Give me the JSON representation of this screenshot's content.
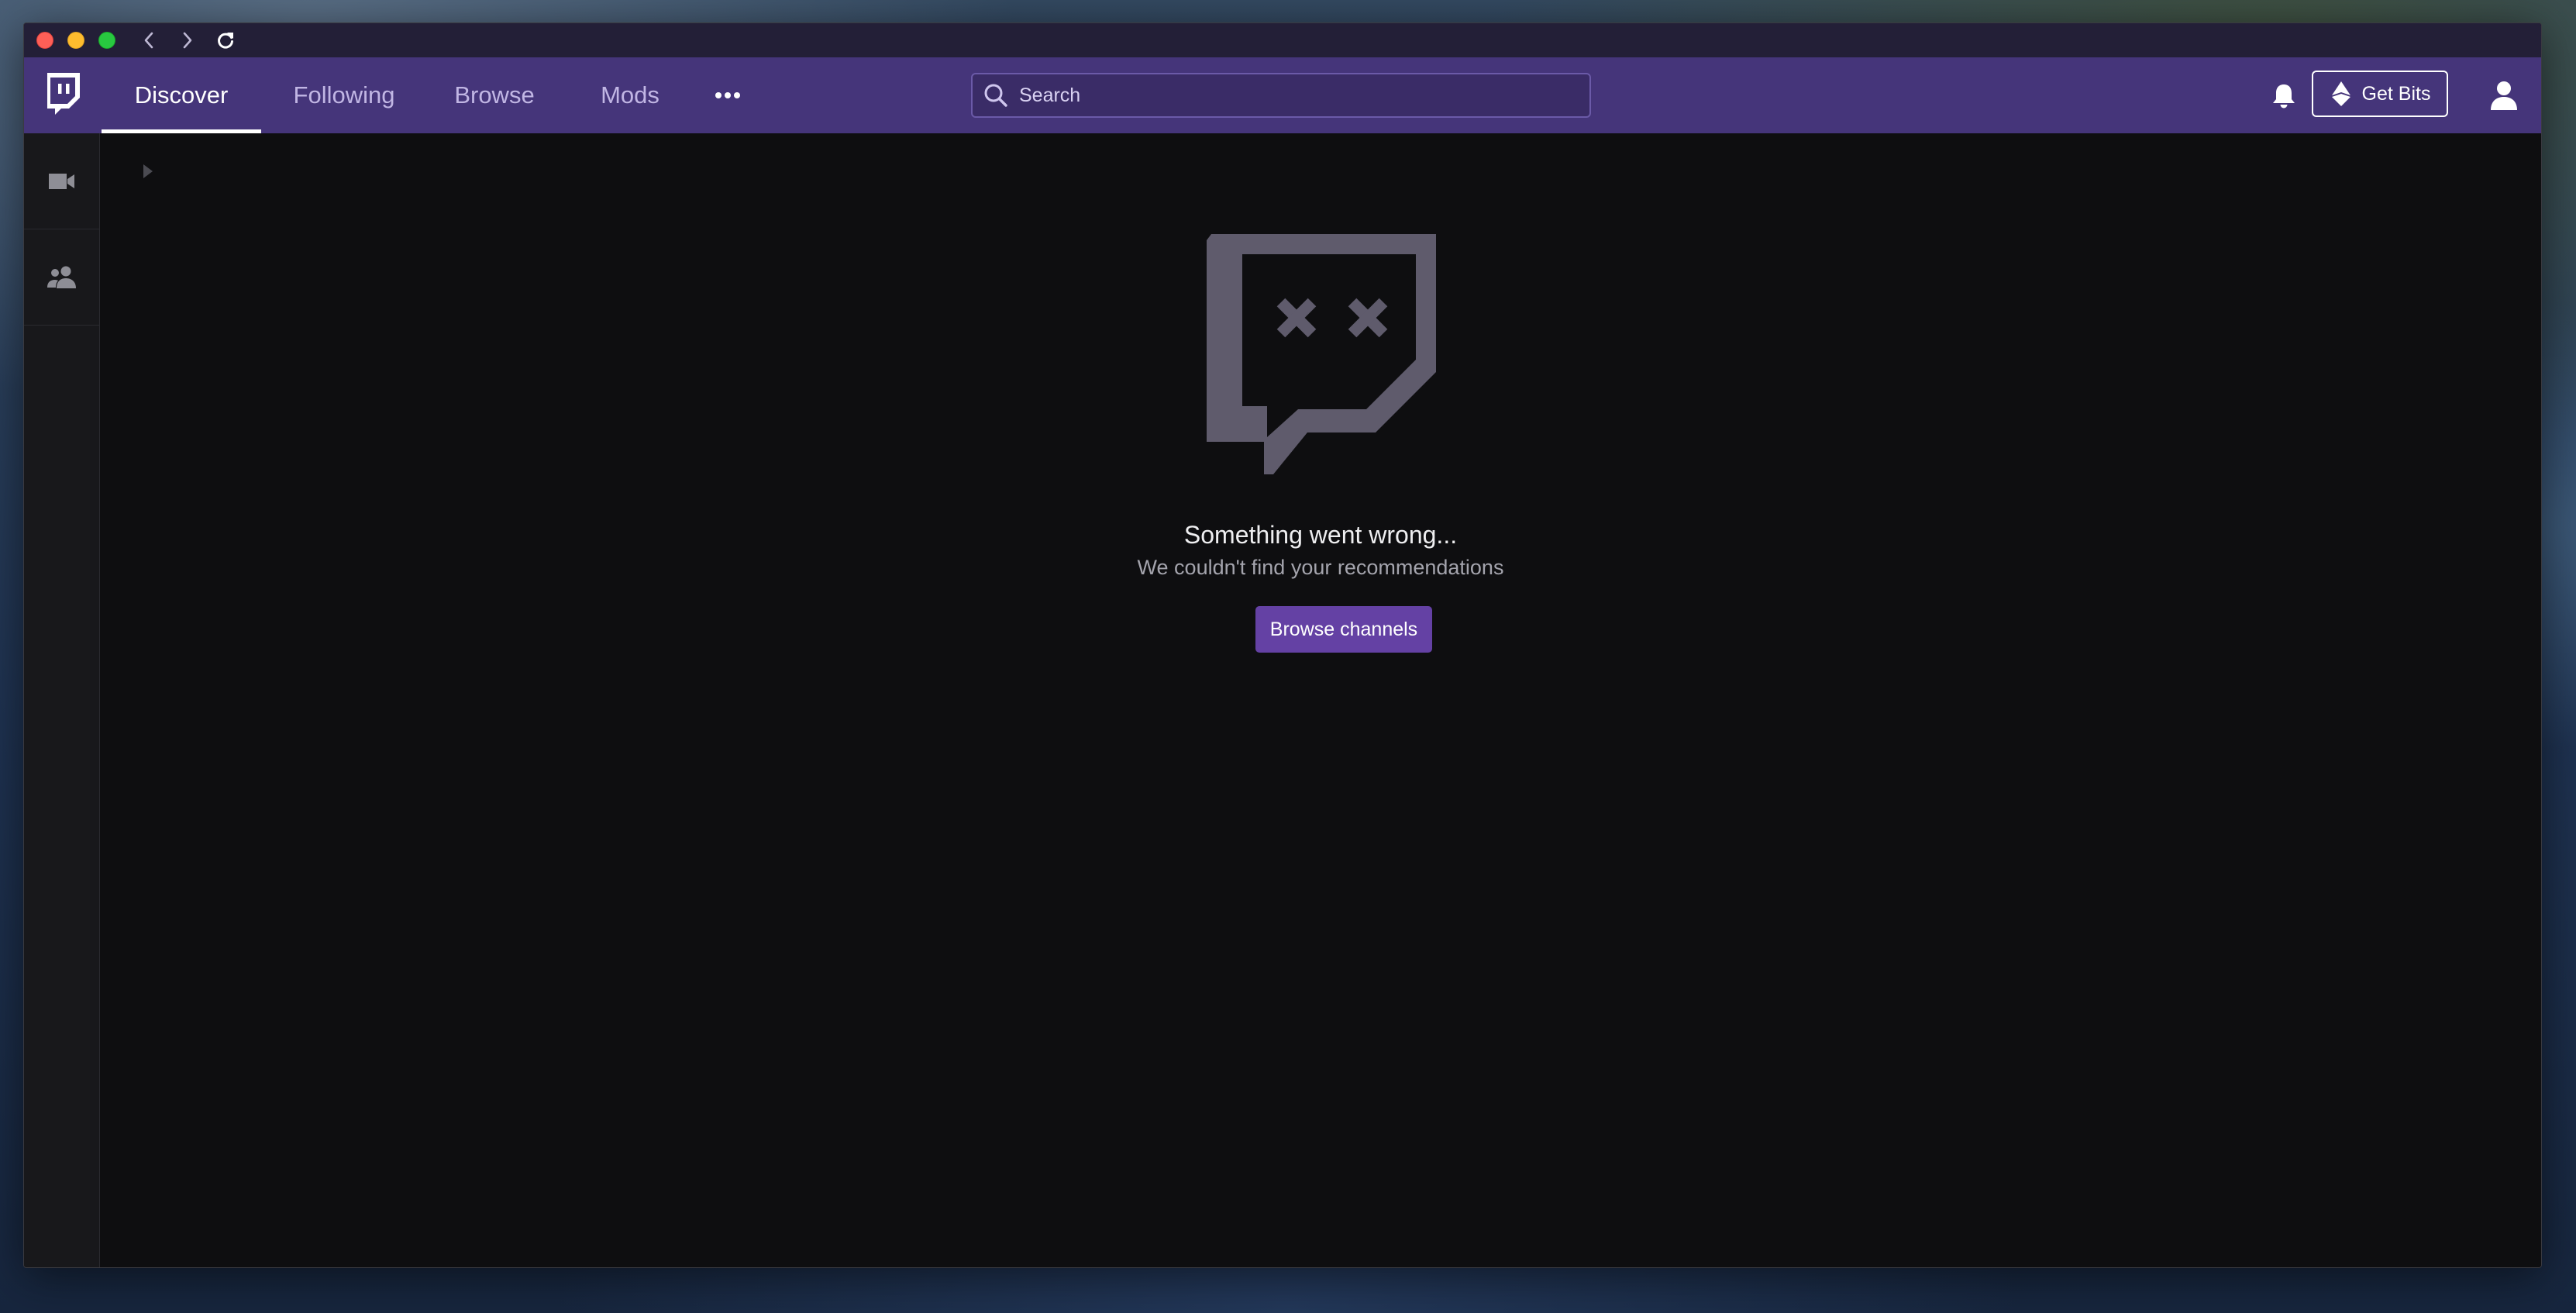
{
  "nav": {
    "tabs": [
      {
        "label": "Discover",
        "active": true
      },
      {
        "label": "Following",
        "active": false
      },
      {
        "label": "Browse",
        "active": false
      },
      {
        "label": "Mods",
        "active": false
      }
    ],
    "more_icon": "more-icon"
  },
  "search": {
    "placeholder": "Search"
  },
  "header": {
    "get_bits_label": "Get Bits"
  },
  "error": {
    "title": "Something went wrong...",
    "subtitle": "We couldn't find your recommendations",
    "button_label": "Browse channels"
  },
  "colors": {
    "nav_bg": "#45357a",
    "titlebar_bg": "#231f37",
    "accent": "#6441a4",
    "content_bg": "#0e0e10",
    "sidebar_bg": "#18181b"
  },
  "icons": {
    "logo": "twitch-logo-icon",
    "bell": "bell-icon",
    "bits": "bits-icon",
    "user": "user-icon",
    "sidebar": [
      "video-camera-icon",
      "users-icon"
    ],
    "error": "broken-chat-glitch-icon"
  }
}
